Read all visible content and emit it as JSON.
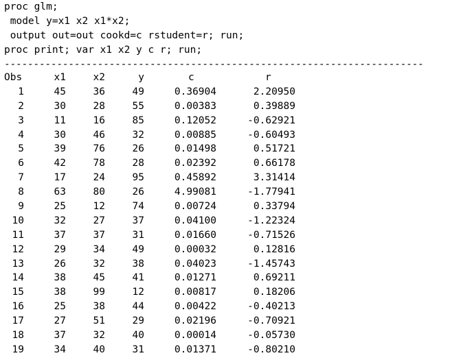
{
  "code": {
    "lines": [
      "proc glm;",
      " model y=x1 x2 x1*x2;",
      " output out=out cookd=c rstudent=r; run;",
      "proc print; var x1 x2 y c r; run;"
    ],
    "divider": "------------------------------------------------------------------------"
  },
  "table": {
    "headers": [
      "Obs",
      "x1",
      "x2",
      "y",
      "c",
      "r"
    ],
    "rows": [
      [
        "1",
        "45",
        "36",
        "49",
        "0.36904",
        "2.20950"
      ],
      [
        "2",
        "30",
        "28",
        "55",
        "0.00383",
        "0.39889"
      ],
      [
        "3",
        "11",
        "16",
        "85",
        "0.12052",
        "-0.62921"
      ],
      [
        "4",
        "30",
        "46",
        "32",
        "0.00885",
        "-0.60493"
      ],
      [
        "5",
        "39",
        "76",
        "26",
        "0.01498",
        "0.51721"
      ],
      [
        "6",
        "42",
        "78",
        "28",
        "0.02392",
        "0.66178"
      ],
      [
        "7",
        "17",
        "24",
        "95",
        "0.45892",
        "3.31414"
      ],
      [
        "8",
        "63",
        "80",
        "26",
        "4.99081",
        "-1.77941"
      ],
      [
        "9",
        "25",
        "12",
        "74",
        "0.00724",
        "0.33794"
      ],
      [
        "10",
        "32",
        "27",
        "37",
        "0.04100",
        "-1.22324"
      ],
      [
        "11",
        "37",
        "37",
        "31",
        "0.01660",
        "-0.71526"
      ],
      [
        "12",
        "29",
        "34",
        "49",
        "0.00032",
        "0.12816"
      ],
      [
        "13",
        "26",
        "32",
        "38",
        "0.04023",
        "-1.45743"
      ],
      [
        "14",
        "38",
        "45",
        "41",
        "0.01271",
        "0.69211"
      ],
      [
        "15",
        "38",
        "99",
        "12",
        "0.00817",
        "0.18206"
      ],
      [
        "16",
        "25",
        "38",
        "44",
        "0.00422",
        "-0.40213"
      ],
      [
        "17",
        "27",
        "51",
        "29",
        "0.02196",
        "-0.70921"
      ],
      [
        "18",
        "37",
        "32",
        "40",
        "0.00014",
        "-0.05730"
      ],
      [
        "19",
        "34",
        "40",
        "31",
        "0.01371",
        "-0.80210"
      ]
    ]
  }
}
